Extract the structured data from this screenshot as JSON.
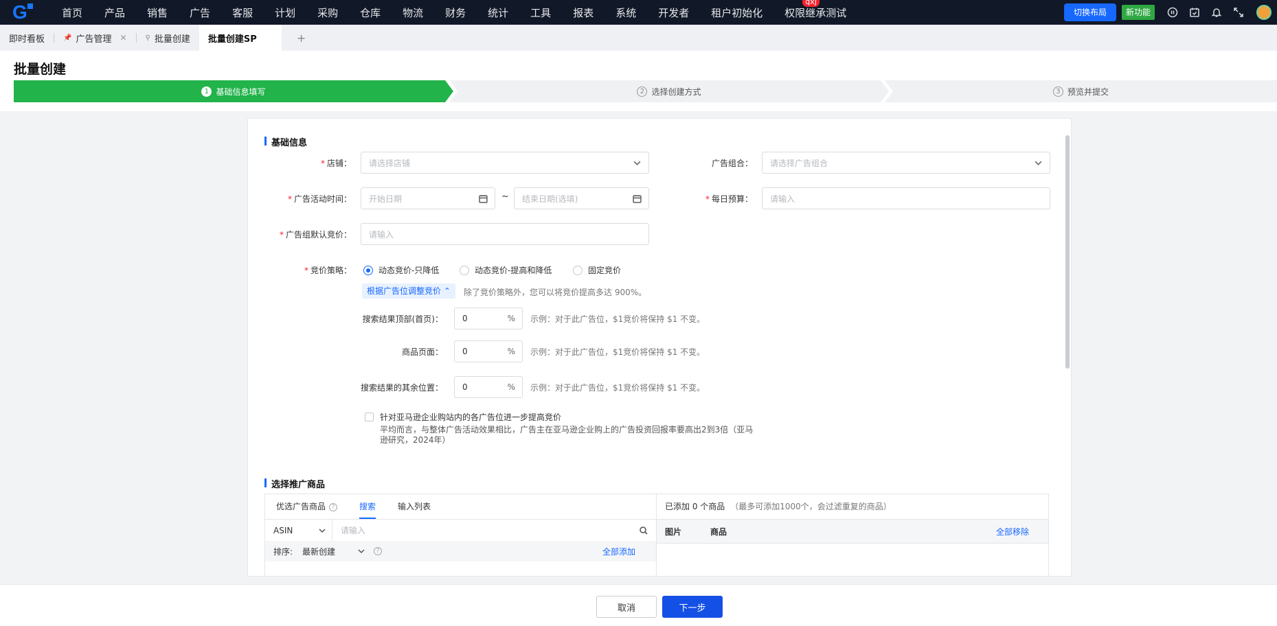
{
  "nav": {
    "items": [
      "首页",
      "产品",
      "销售",
      "广告",
      "客服",
      "计划",
      "采购",
      "仓库",
      "物流",
      "财务",
      "统计",
      "工具",
      "报表",
      "系统",
      "开发者",
      "租户初始化",
      "权限继承测试"
    ],
    "badge": "qxj",
    "switch_layout": "切换布局",
    "new_feature": "新功能",
    "icons": [
      "help-circle-icon",
      "calendar-check-icon",
      "bell-icon",
      "fullscreen-icon"
    ]
  },
  "tabs": {
    "items": [
      {
        "label": "即时看板",
        "pinned": false,
        "closable": false
      },
      {
        "label": "广告管理",
        "pinned": true,
        "closable": true
      },
      {
        "label": "批量创建",
        "pinned": true,
        "closable": false
      },
      {
        "label": "批量创建SP",
        "pinned": false,
        "closable": false
      }
    ],
    "add": "+"
  },
  "page": {
    "title": "批量创建"
  },
  "steps": [
    {
      "num": "1",
      "label": "基础信息填写",
      "active": true
    },
    {
      "num": "2",
      "label": "选择创建方式",
      "active": false
    },
    {
      "num": "3",
      "label": "预览并提交",
      "active": false
    }
  ],
  "basic": {
    "title": "基础信息",
    "shop_label": "店铺：",
    "shop_placeholder": "请选择店铺",
    "portfolio_label": "广告组合：",
    "portfolio_placeholder": "请选择广告组合",
    "time_label": "广告活动时间：",
    "start_placeholder": "开始日期",
    "tilde": "~",
    "end_placeholder": "结束日期(选填)",
    "budget_label": "每日预算：",
    "budget_placeholder": "请输入",
    "bid_label": "广告组默认竞价：",
    "bid_placeholder": "请输入",
    "strategy_label": "竞价策略：",
    "strategies": [
      {
        "label": "动态竞价-只降低",
        "selected": true
      },
      {
        "label": "动态竞价-提高和降低",
        "selected": false
      },
      {
        "label": "固定竞价",
        "selected": false
      }
    ],
    "adjust_button": "根据广告位调整竞价 ⌃",
    "adjust_hint": "除了竞价策略外，您可以将竞价提高多达 900%。",
    "placements": [
      {
        "label": "搜索结果顶部(首页)：",
        "value": "0",
        "unit": "%",
        "hint": "示例：对于此广告位，$1竞价将保持 $1 不变。"
      },
      {
        "label": "商品页面：",
        "value": "0",
        "unit": "%",
        "hint": "示例：对于此广告位，$1竞价将保持 $1 不变。"
      },
      {
        "label": "搜索结果的其余位置：",
        "value": "0",
        "unit": "%",
        "hint": "示例：对于此广告位，$1竞价将保持 $1 不变。"
      }
    ],
    "business_checkbox_label": "针对亚马逊企业购站内的各广告位进一步提高竞价",
    "business_desc": "平均而言，与整体广告活动效果相比，广告主在亚马逊企业购上的广告投资回报率要高出2到3倍（亚马逊研究，2024年）"
  },
  "products": {
    "title": "选择推广商品",
    "tabs": [
      "优选广告商品",
      "搜索",
      "输入列表"
    ],
    "active_tab": "搜索",
    "search_type": "ASIN",
    "search_placeholder": "请输入",
    "sort_label": "排序:",
    "sort_value": "最新创建",
    "add_all": "全部添加",
    "added_text": "已添加 0 个商品",
    "added_note": "（最多可添加1000个，会过滤重复的商品）",
    "col_image": "图片",
    "col_product": "商品",
    "remove_all": "全部移除"
  },
  "footer": {
    "cancel": "取消",
    "next": "下一步"
  },
  "colors": {
    "primary": "#1668ff",
    "step_active": "#22b34a",
    "nav_bg": "#111827",
    "required": "#f5222d"
  }
}
